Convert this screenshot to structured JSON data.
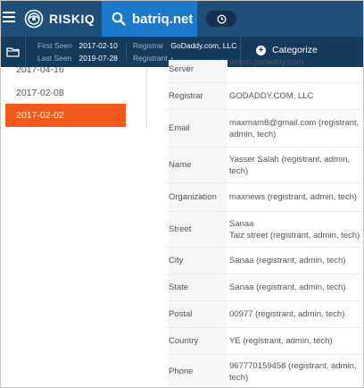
{
  "app": {
    "logo_text": "RISKIQ",
    "search_query": "batriq.net"
  },
  "summary": {
    "first_seen_label": "First Seen",
    "first_seen": "2017-02-10",
    "last_seen_label": "Last Seen",
    "last_seen": "2019-07-28",
    "registrar_label": "Registrar",
    "registrar": "GoDaddy.com, LLC",
    "registrant_label": "Registrant",
    "registrant": "-",
    "categorize_label": "Categorize"
  },
  "dates": [
    {
      "label": "2017-04-16",
      "active": false
    },
    {
      "label": "2017-02-08",
      "active": false
    },
    {
      "label": "2017-02-02",
      "active": true
    }
  ],
  "whois_rows": [
    {
      "key": "Server",
      "value": "whois.godaddy.com"
    },
    {
      "key": "Registrar",
      "value": "GODADDY.COM, LLC"
    },
    {
      "key": "Email",
      "value": "maxmam8@gmail.com (registrant, admin, tech)"
    },
    {
      "key": "Name",
      "value": "Yasser Salah (registrant, admin, tech)"
    },
    {
      "key": "Organization",
      "value": "maxnews (registrant, admin, tech)"
    },
    {
      "key": "Street",
      "value": "Sanaa",
      "value2": "Taiz street (registrant, admin, tech)"
    },
    {
      "key": "City",
      "value": "Sanaa (registrant, admin, tech)"
    },
    {
      "key": "State",
      "value": "Sanaa (registrant, admin, tech)"
    },
    {
      "key": "Postal",
      "value": "00977 (registrant, admin, tech)"
    },
    {
      "key": "Country",
      "value": "YE (registrant, admin, tech)"
    },
    {
      "key": "Phone",
      "value": "967770159458 (registrant, admin, tech)"
    }
  ],
  "colors": {
    "topbar": "#1f4e79",
    "search_tab": "#1c78c8",
    "subbar": "#143a5c",
    "active_date": "#f4581b"
  },
  "icons": [
    "menu-icon",
    "riskiq-logo-icon",
    "search-icon",
    "history-icon",
    "folder-icon",
    "plus-icon"
  ]
}
